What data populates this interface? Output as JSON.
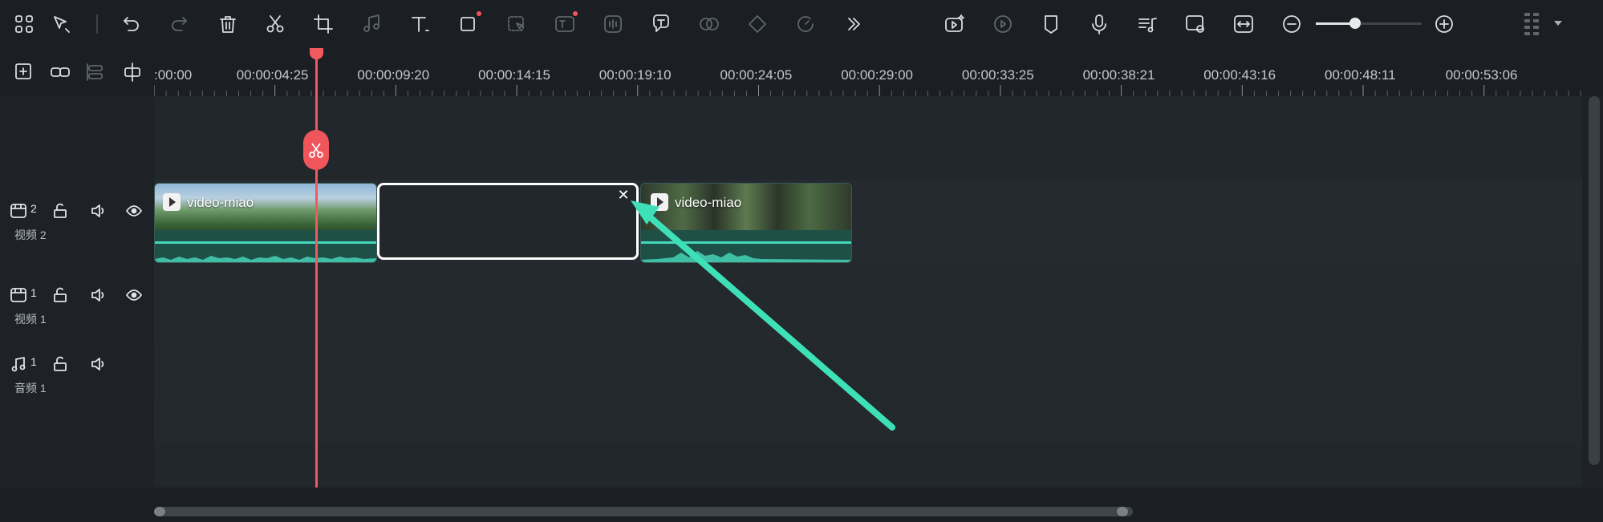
{
  "toolbar": {
    "left_icons": [
      "apps-icon",
      "select-tool-icon",
      "undo-icon",
      "redo-icon",
      "delete-icon",
      "cut-icon",
      "crop-icon",
      "audio-adjust-icon",
      "text-icon",
      "shape-icon",
      "ai-select-icon",
      "ai-text-icon",
      "voice-icon",
      "speech-text-icon",
      "tts-icon",
      "keyframe-icon",
      "speed-icon",
      "more-icon"
    ],
    "right_icons": [
      "ai-clip-icon",
      "render-icon",
      "marker-icon",
      "microphone-icon",
      "music-icon",
      "preview-icon",
      "fit-icon",
      "zoom-out-icon",
      "zoom-in-icon"
    ],
    "zoom_level": 0.37
  },
  "ruler": {
    "timecodes": [
      ":00:00",
      "00:00:04:25",
      "00:00:09:20",
      "00:00:14:15",
      "00:00:19:10",
      "00:00:24:05",
      "00:00:29:00",
      "00:00:33:25",
      "00:00:38:21",
      "00:00:43:16",
      "00:00:48:11",
      "00:00:53:06"
    ]
  },
  "tracks": [
    {
      "num": "2",
      "name": "视频 2"
    },
    {
      "num": "1",
      "name": "视频 1"
    },
    {
      "num": "1",
      "name": "音频 1"
    }
  ],
  "clips": [
    {
      "title": "video-miao"
    },
    {
      "title": "video-miao"
    }
  ],
  "gap": {
    "close_glyph": "✕"
  },
  "colors": {
    "accent": "#f05a5f",
    "wave": "#47d7bd",
    "arrow": "#3ee0b8"
  }
}
